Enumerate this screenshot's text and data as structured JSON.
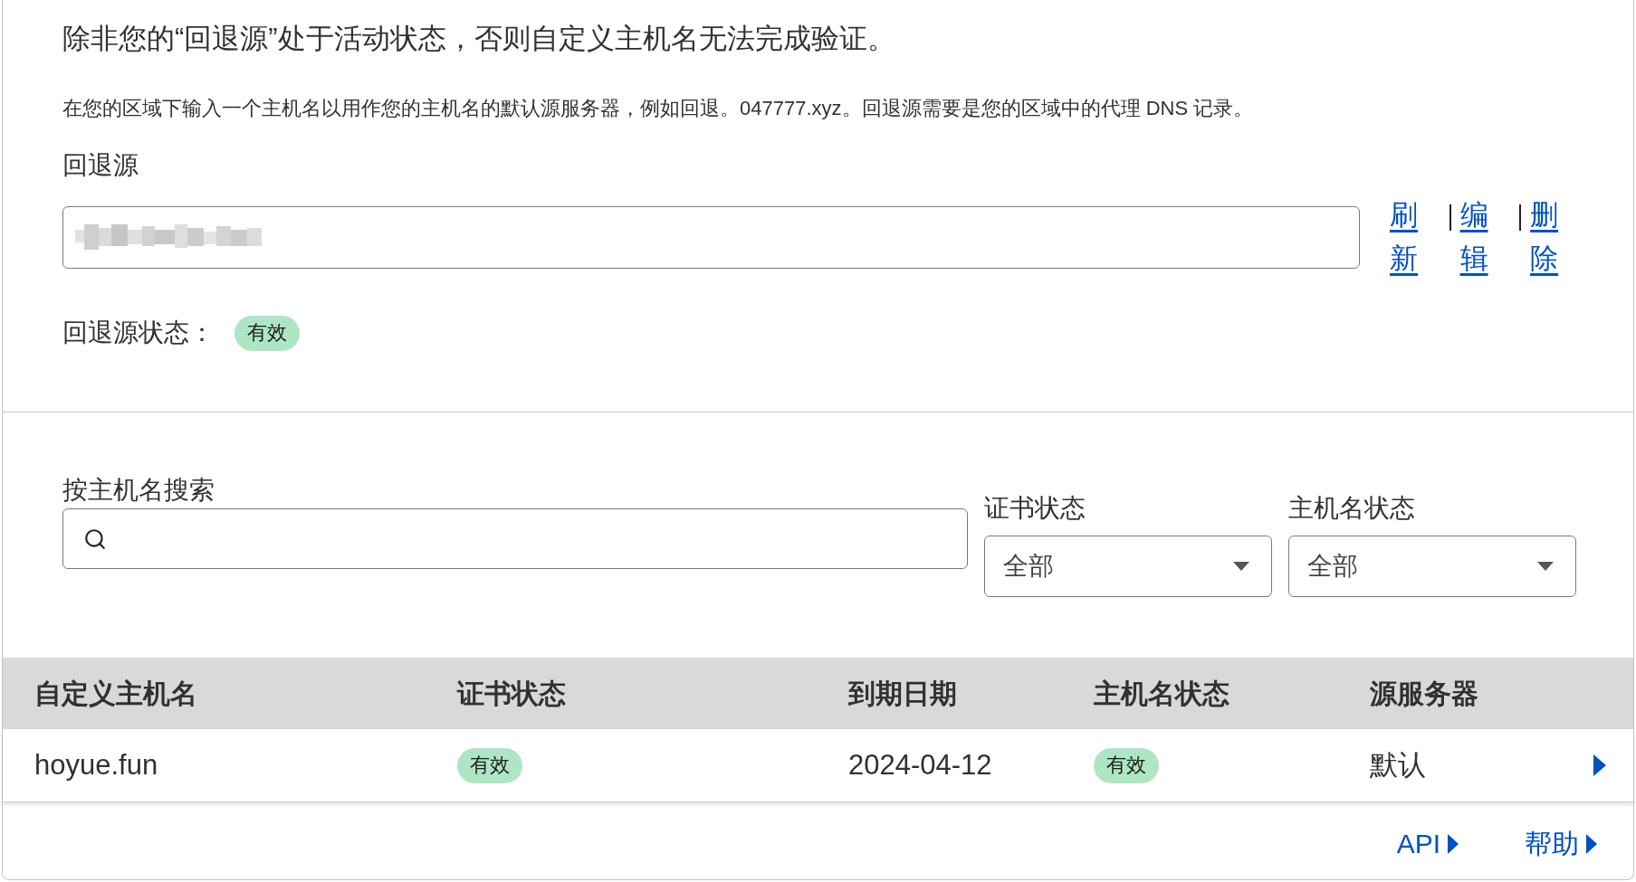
{
  "fallback_origin": {
    "heading": "除非您的“回退源”处于活动状态，否则自定义主机名无法完成验证。",
    "description": "在您的区域下输入一个主机名以用作您的主机名的默认源服务器，例如回退。047777.xyz。回退源需要是您的区域中的代理 DNS 记录。",
    "field_label": "回退源",
    "value_redacted": true,
    "actions": [
      "刷新",
      "编辑",
      "删除"
    ],
    "status_label": "回退源状态：",
    "status": "有效"
  },
  "filters": {
    "search": {
      "label": "按主机名搜索"
    },
    "selects": [
      {
        "label": "证书状态",
        "value": "全部"
      },
      {
        "label": "主机名状态",
        "value": "全部"
      }
    ]
  },
  "table": {
    "columns": [
      "自定义主机名",
      "证书状态",
      "到期日期",
      "主机名状态",
      "源服务器"
    ],
    "rows": [
      {
        "cells": [
          {
            "kind": "text",
            "text": "hoyue.fun"
          },
          {
            "kind": "badge",
            "text": "有效"
          },
          {
            "kind": "text",
            "text": "2024-04-12"
          },
          {
            "kind": "badge",
            "text": "有效"
          },
          {
            "kind": "text",
            "text": "默认"
          }
        ]
      }
    ]
  },
  "footer_links": [
    "API",
    "帮助"
  ]
}
